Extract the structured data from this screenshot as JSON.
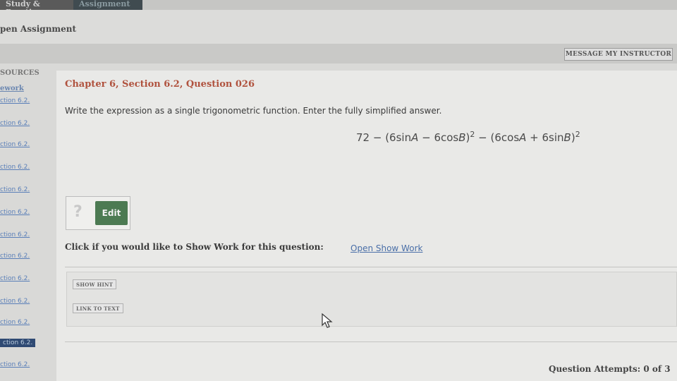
{
  "top_tabs": [
    {
      "label": "Study & Practice"
    },
    {
      "label": "Assignment"
    }
  ],
  "page_title": "pen Assignment",
  "message_button": "MESSAGE MY INSTRUCTOR",
  "sidebar": {
    "heading1": "SOURCES",
    "heading2": "ework",
    "items": [
      {
        "label": "ction 6.2."
      },
      {
        "label": "ction 6.2."
      },
      {
        "label": "ction 6.2."
      },
      {
        "label": "ction 6.2."
      },
      {
        "label": "ction 6.2."
      },
      {
        "label": "ction 6.2."
      },
      {
        "label": "ction 6.2."
      },
      {
        "label": "ction 6.2."
      },
      {
        "label": "ction 6.2."
      },
      {
        "label": "ction 6.2."
      },
      {
        "label": "ction 6.2."
      },
      {
        "label": "ction 6.2."
      },
      {
        "label": "ction 6.2."
      }
    ]
  },
  "question": {
    "chapter": "Chapter 6, Section 6.2, Question 026",
    "instructions": "Write the expression as a single trigonometric function. Enter the fully simplified answer.",
    "expression": {
      "part1": "72 − (6sin",
      "var1": "A",
      "part2": " − 6cos",
      "var2": "B",
      "part3": ")",
      "exp1": "2",
      "part4": " − (6cos",
      "var3": "A",
      "part5": " + 6sin",
      "var4": "B",
      "part6": ")",
      "exp2": "2"
    }
  },
  "answer": {
    "help_icon": "?",
    "edit_label": "Edit"
  },
  "show_work": {
    "label": "Click if you would like to Show Work for this question:",
    "link": "Open Show Work"
  },
  "hint_buttons": {
    "show_hint": "SHOW HINT",
    "link_to_text": "LINK TO TEXT"
  },
  "attempts": "Question Attempts: 0 of 3"
}
